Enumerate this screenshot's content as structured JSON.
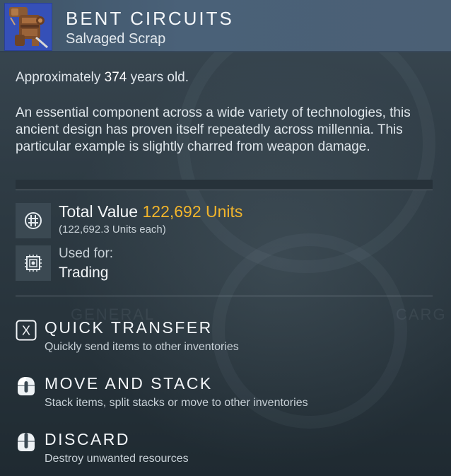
{
  "item": {
    "name": "BENT CIRCUITS",
    "category": "Salvaged Scrap",
    "age_prefix": "Approximately ",
    "age_value": "374",
    "age_suffix": " years old.",
    "description": "An essential component across a wide variety of technologies, this ancient design has proven itself repeatedly across millennia. This particular example is slightly charred from weapon damage."
  },
  "stats": {
    "total_value_label": "Total Value",
    "total_value": "122,692 Units",
    "each_value": "(122,692.3 Units each)",
    "used_for_label": "Used for:",
    "used_for_value": "Trading"
  },
  "actions": [
    {
      "key": "X",
      "label": "QUICK TRANSFER",
      "description": "Quickly send items to other inventories"
    },
    {
      "label": "MOVE AND STACK",
      "description": "Stack items, split stacks or move to other inventories"
    },
    {
      "label": "DISCARD",
      "description": "Destroy unwanted resources"
    }
  ],
  "background": {
    "left_label": "GENERAL",
    "right_label": "CARG"
  },
  "colors": {
    "header": "#4a6178",
    "accent_units": "#f2b52b",
    "icon_bg": "#3550b8"
  },
  "icons": [
    "item-icon",
    "units-currency-icon",
    "trade-chip-icon",
    "x-button-icon",
    "mouse-left-icon",
    "mouse-right-icon"
  ]
}
